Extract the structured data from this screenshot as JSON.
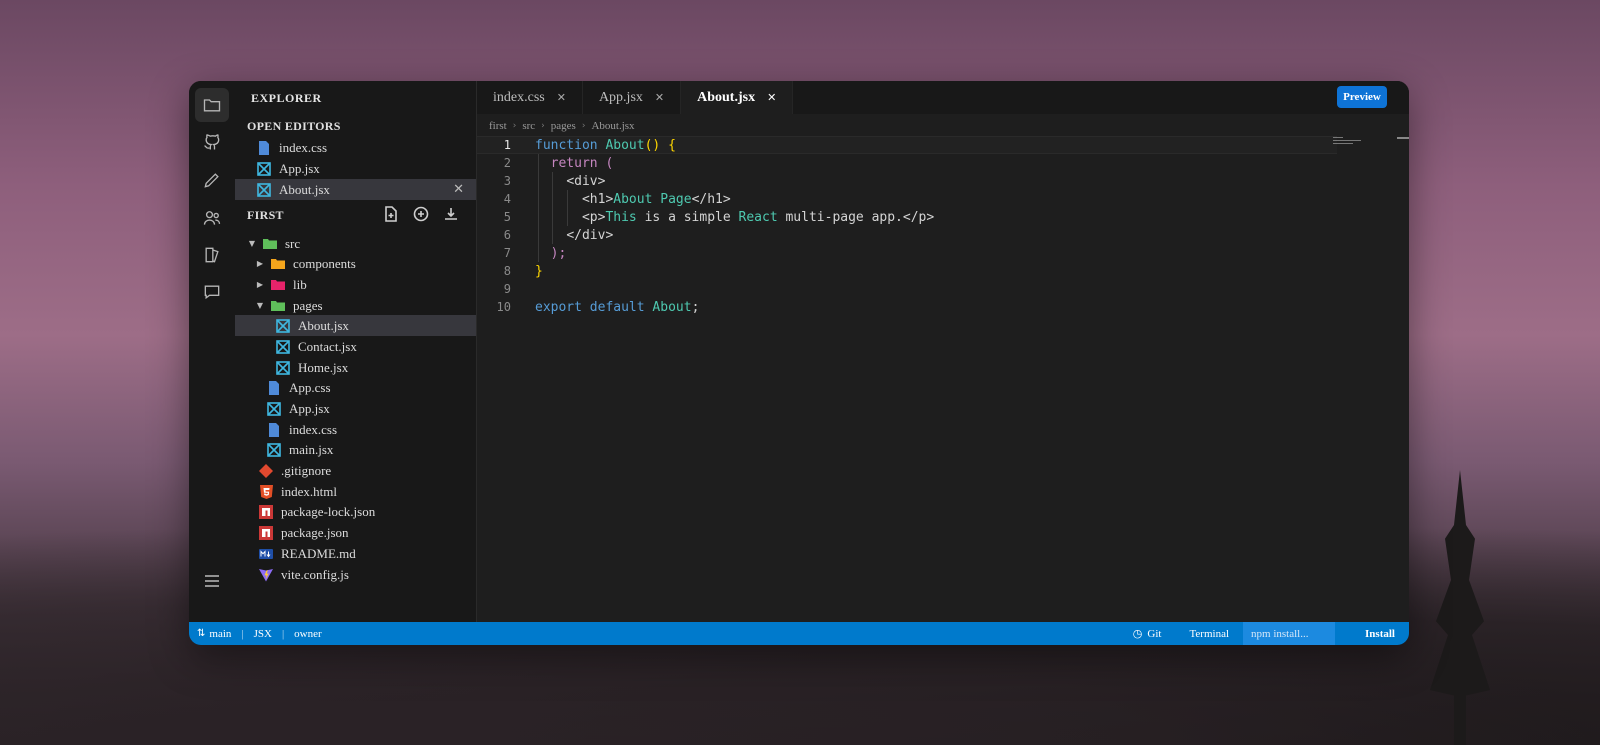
{
  "sidebar": {
    "title": "EXPLORER",
    "open_editors_title": "OPEN EDITORS",
    "open_editors": [
      "index.css",
      "App.jsx",
      "About.jsx"
    ],
    "project_title": "FIRST",
    "tree": {
      "src": "src",
      "components": "components",
      "lib": "lib",
      "pages": "pages",
      "about": "About.jsx",
      "contact": "Contact.jsx",
      "home": "Home.jsx",
      "app_css": "App.css",
      "app_jsx": "App.jsx",
      "index_css": "index.css",
      "main_jsx": "main.jsx",
      "gitignore": ".gitignore",
      "index_html": "index.html",
      "package_lock": "package-lock.json",
      "package_json": "package.json",
      "readme": "README.md",
      "vite_config": "vite.config.js"
    }
  },
  "tabs": [
    "index.css",
    "App.jsx",
    "About.jsx"
  ],
  "preview_label": "Preview",
  "breadcrumb": [
    "first",
    "src",
    "pages",
    "About.jsx"
  ],
  "code": {
    "line_numbers": [
      "1",
      "2",
      "3",
      "4",
      "5",
      "6",
      "7",
      "8",
      "9",
      "10"
    ],
    "l1": {
      "kw": "function",
      "name": "About",
      "rest": "() {"
    },
    "l2": {
      "kw": "return",
      "rest": " ("
    },
    "l3": "<div>",
    "l4": {
      "open": "<h1>",
      "text": "About Page",
      "close": "</h1>"
    },
    "l5": {
      "open": "<p>",
      "t1": "This",
      "t2": " is a simple ",
      "t3": "React",
      "t4": " multi-page app.",
      "close": "</p>"
    },
    "l6": "</div>",
    "l7": ");",
    "l8": "}",
    "l10": {
      "kw1": "export",
      "kw2": "default",
      "name": "About",
      "end": ";"
    }
  },
  "status": {
    "branch": "main",
    "language": "JSX",
    "user": "owner",
    "git": "Git",
    "terminal": "Terminal",
    "npm_placeholder": "npm install...",
    "install": "Install"
  },
  "colors": {
    "accent": "#007acc",
    "preview": "#0e73d6"
  }
}
